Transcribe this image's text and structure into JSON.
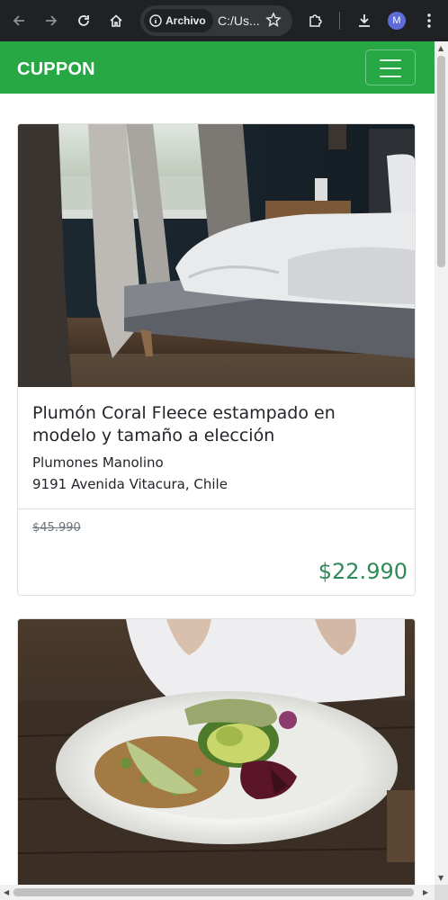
{
  "browser": {
    "chip_label": "Archivo",
    "url": "C:/Us...",
    "profile_initial": "M"
  },
  "navbar": {
    "brand": "CUPPON"
  },
  "cards": [
    {
      "title": "Plumón Coral Fleece estampado en modelo y tamaño a elección",
      "vendor": "Plumones Manolino",
      "address": "9191 Avenida Vitacura, Chile",
      "old_price": "$45.990",
      "new_price": "$22.990"
    }
  ],
  "colors": {
    "navbar": "#28a745",
    "price": "#2e8b57",
    "chrome": "#202124"
  }
}
